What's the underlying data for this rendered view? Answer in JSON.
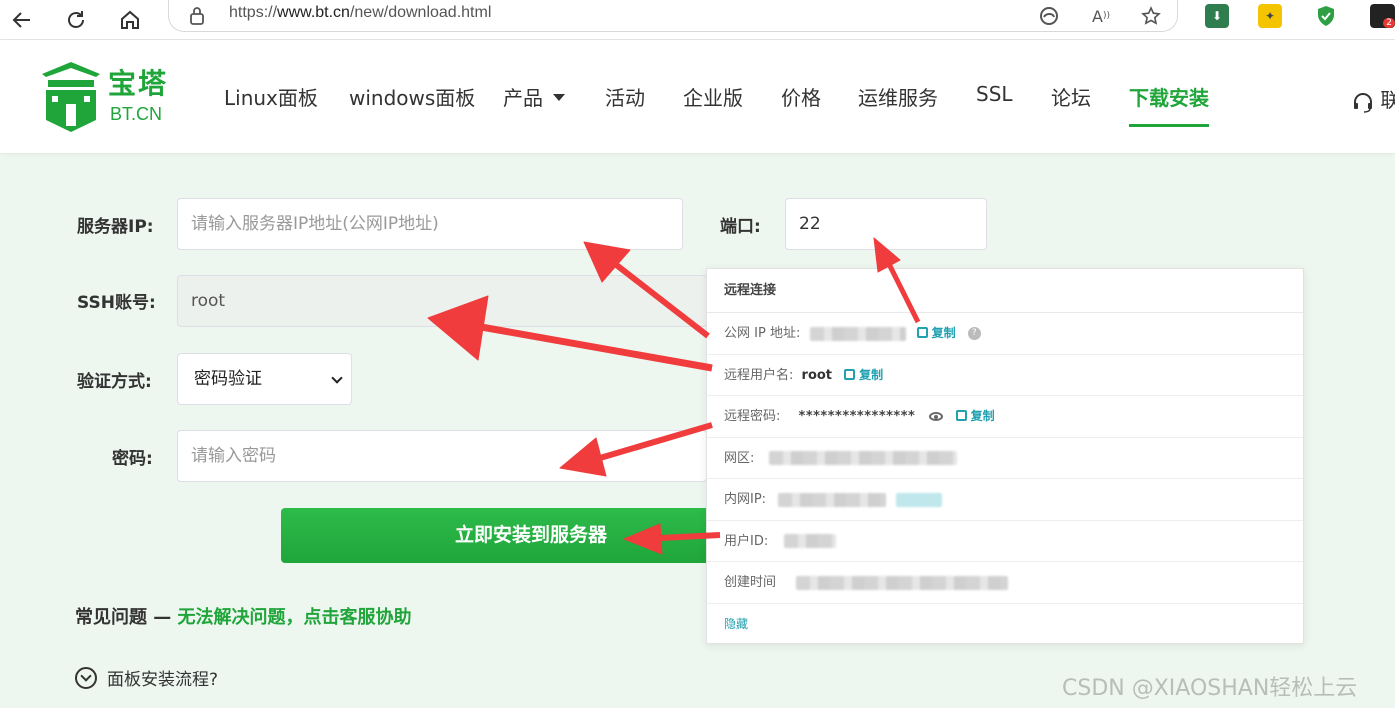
{
  "browser": {
    "url_prefix": "https://",
    "url_host": "www.bt.cn",
    "url_path": "/new/download.html",
    "ext_badge": "2"
  },
  "header": {
    "logo_cn": "宝塔",
    "logo_en": "BT.CN",
    "nav": [
      "Linux面板",
      "windows面板",
      "产品",
      "活动",
      "企业版",
      "价格",
      "运维服务",
      "SSL",
      "论坛",
      "下载安装"
    ],
    "contact": "联"
  },
  "form": {
    "ip_label": "服务器IP:",
    "ip_placeholder": "请输入服务器IP地址(公网IP地址)",
    "port_label": "端口:",
    "port_value": "22",
    "ssh_label": "SSH账号:",
    "ssh_value": "root",
    "auth_label": "验证方式:",
    "auth_value": "密码验证",
    "pwd_label": "密码:",
    "pwd_placeholder": "请输入密码",
    "install_button": "立即安装到服务器"
  },
  "faq": {
    "title": "常见问题 — ",
    "link": "无法解决问题，点击客服协助",
    "item1": "面板安装流程?"
  },
  "panel": {
    "title": "远程连接",
    "ip_label": "公网 IP 地址:",
    "user_label": "远程用户名:",
    "user_value": "root",
    "pwd_label": "远程密码:",
    "pwd_value": "****************",
    "zone_label": "网区:",
    "inner_ip_label": "内网IP:",
    "uid_label": "用户ID:",
    "created_label": "创建时间",
    "copy": "复制",
    "help": "?",
    "hide": "隐藏"
  },
  "watermark": "CSDN @XIAOSHAN轻松上云",
  "colors": {
    "brand_green": "#20a53a",
    "arrow_red": "#f03c3c",
    "copy_teal": "#20a0b0"
  },
  "icons": [
    "back-icon",
    "refresh-icon",
    "home-icon",
    "lock-icon",
    "edge-icon",
    "read-aloud-icon",
    "star-icon",
    "copy-icon",
    "help-icon",
    "eye-icon",
    "headset-icon",
    "chevron-down-icon"
  ]
}
